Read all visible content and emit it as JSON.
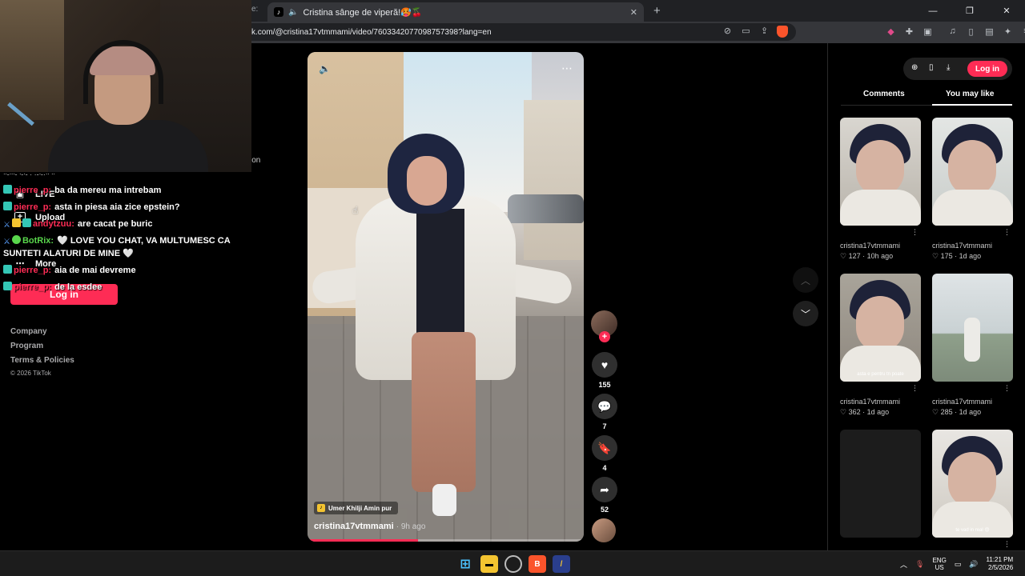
{
  "browser": {
    "tab_title": "Cristina sânge de viperă!🥵🍒",
    "url": "k.com/@cristina17vtmmami/video/7603342077098757398?lang=en",
    "tab_prev": "e:"
  },
  "sidebar": {
    "partial_top": "ᐧᐧ-ᐧᐧᐧ- ᐧ-ᐧ- · ·-ᐧ-·ᐧᐧ ᐧᐧ",
    "partial_right": "ion",
    "items": [
      {
        "label": "LIVE",
        "icon": "live-icon"
      },
      {
        "label": "Upload",
        "icon": "upload-icon"
      },
      {
        "label": "More",
        "icon": "more-icon"
      }
    ],
    "login_label": "Log in",
    "footer_links": [
      "Company",
      "Program",
      "Terms & Policies"
    ],
    "copyright": "© 2026 TikTok"
  },
  "chat": [
    {
      "user": "pierre_p:",
      "user_color": "#fe2c55",
      "text": "ba da mereu ma intrebam"
    },
    {
      "user": "pierre_p:",
      "user_color": "#fe2c55",
      "text": "asta in piesa aia zice epstein?"
    },
    {
      "user": "andytzuu:",
      "user_color": "#fe2c55",
      "text": "are cacat pe buric"
    },
    {
      "user": "BotRix:",
      "user_color": "#59d64c",
      "text": "🤍 LOVE YOU CHAT, VA MULTUMESC CA SUNTETI ALATURI DE MINE 🤍"
    },
    {
      "user": "pierre_p:",
      "user_color": "#fe2c55",
      "text": "aia de mai devreme"
    },
    {
      "user": "pierre_p:",
      "user_color": "#fe2c55",
      "text": "de la esdee"
    }
  ],
  "video": {
    "sound_label": "Umer Khilji Amin pur",
    "author": "cristina17vtmmami",
    "time_ago": "· 9h ago",
    "progress": 0.4
  },
  "actions": {
    "likes": "155",
    "comments": "7",
    "saves": "4",
    "shares": "52"
  },
  "right_panel": {
    "login_label": "Log in",
    "tabs": [
      "Comments",
      "You may like"
    ],
    "active_tab": 1,
    "cards": [
      {
        "user": "cristina17vtmmami",
        "likes": "127",
        "ago": "10h ago",
        "caption": ""
      },
      {
        "user": "cristina17vtmmami",
        "likes": "175",
        "ago": "1d ago",
        "caption": ""
      },
      {
        "user": "cristina17vtmmami",
        "likes": "362",
        "ago": "1d ago",
        "caption": "asta e pentru tn poate"
      },
      {
        "user": "cristina17vtmmami",
        "likes": "285",
        "ago": "1d ago",
        "caption": ""
      },
      {
        "user": "",
        "likes": "",
        "ago": "",
        "caption": ""
      },
      {
        "user": "",
        "likes": "",
        "ago": "",
        "caption": "te vad in real 😍"
      }
    ]
  },
  "taskbar": {
    "lang_top": "ENG",
    "lang_bottom": "US",
    "time": "11:21 PM",
    "date": "2/5/2026"
  },
  "colors": {
    "accent": "#fe2c55",
    "background": "#000000",
    "panel": "#1f1f1f"
  }
}
